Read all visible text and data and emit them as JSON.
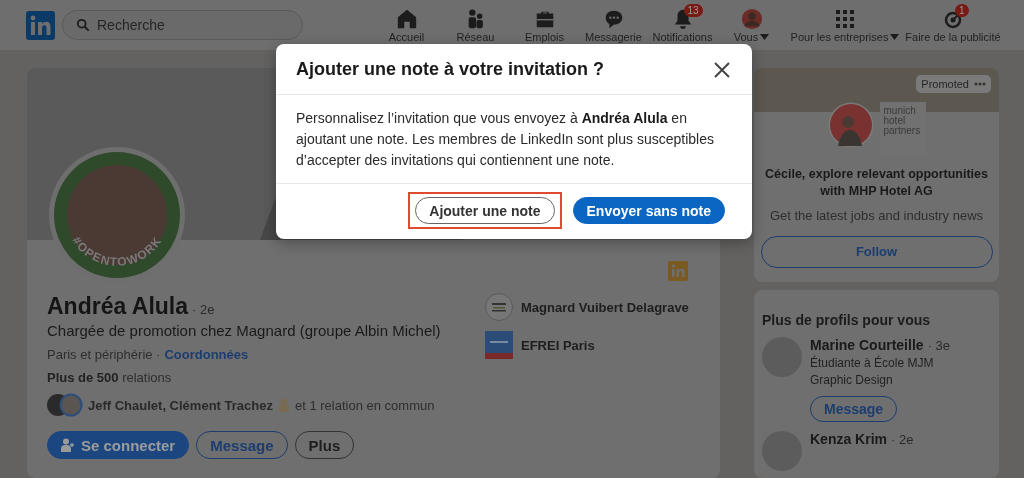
{
  "nav": {
    "search": {
      "placeholder": "Recherche"
    },
    "items": [
      {
        "label": "Accueil"
      },
      {
        "label": "Réseau"
      },
      {
        "label": "Emplois"
      },
      {
        "label": "Messagerie"
      },
      {
        "label": "Notifications",
        "badge": "13"
      },
      {
        "label": "Vous",
        "caret": true
      }
    ],
    "business": {
      "label": "Pour les entreprises"
    },
    "ads": {
      "label": "Faire de la publicité",
      "badge": "1"
    }
  },
  "profile": {
    "open_to_work": "#OPENTOWORK",
    "name": "Andréa Alula",
    "degree": "· 2e",
    "headline": "Chargée de promotion chez Magnard (groupe Albin Michel)",
    "location": "Paris et périphérie ·",
    "contact_link": "Coordonnées",
    "connections": "**Plus de 500** relations",
    "mutual_names": "Jeff Chaulet, Clément Trachez",
    "mutual_rest": "et 1 relation en commun",
    "organizations": [
      {
        "name": "Magnard Vuibert Delagrave"
      },
      {
        "name": "EFREI Paris"
      }
    ],
    "actions": [
      {
        "label": "Se connecter",
        "kind": "primary"
      },
      {
        "label": "Message",
        "kind": "outline"
      },
      {
        "label": "Plus",
        "kind": "neutral"
      }
    ]
  },
  "ad_card": {
    "badge": "Promoted",
    "logo_text": "munich hotel partners",
    "title": "Cécile, explore relevant opportunities with MHP Hotel AG",
    "subtitle": "Get the latest jobs and industry news",
    "button": "Follow"
  },
  "suggestions": {
    "title": "Plus de profils pour vous",
    "people": [
      {
        "name": "Marine Courteille",
        "degree": "· 3e",
        "headline": "Étudiante à École MJM Graphic Design",
        "button": "Message"
      },
      {
        "name": "Kenza Krim",
        "degree": "· 2e"
      }
    ]
  },
  "dialog": {
    "title": "Ajouter une note à votre invitation ?",
    "body": "Personnalisez l’invitation que vous envoyez à **Andréa Alula** en ajoutant une note. Les membres de LinkedIn sont plus susceptibles d’accepter des invitations qui contiennent une note.",
    "buttons": [
      {
        "label": "Ajouter une note",
        "kind": "secondary",
        "highlighted": true
      },
      {
        "label": "Envoyer sans note",
        "kind": "primary",
        "highlighted": false
      }
    ]
  }
}
